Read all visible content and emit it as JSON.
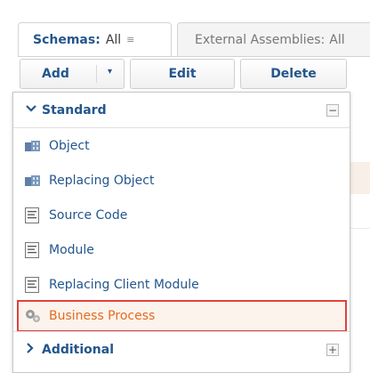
{
  "tabs": {
    "schemas_title": "Schemas:",
    "schemas_value": "All",
    "schemas_arrow": "≡",
    "external_title": "External Assemblies:",
    "external_value": "All"
  },
  "toolbar": {
    "add_label": "Add",
    "add_caret": "▾",
    "edit_label": "Edit",
    "delete_label": "Delete"
  },
  "menu": {
    "standard": {
      "label": "Standard",
      "chevron": "✔",
      "toggle": "−",
      "items": [
        {
          "label": "Object",
          "icon": "object-icon"
        },
        {
          "label": "Replacing Object",
          "icon": "object-icon"
        },
        {
          "label": "Source Code",
          "icon": "document-icon"
        },
        {
          "label": "Module",
          "icon": "document-icon"
        },
        {
          "label": "Replacing Client Module",
          "icon": "document-icon"
        },
        {
          "label": "Business Process",
          "icon": "gears-icon"
        }
      ]
    },
    "additional": {
      "label": "Additional",
      "chevron": "›",
      "toggle": "+"
    }
  },
  "colors": {
    "link": "#24568c",
    "highlight_border": "#e3403a",
    "highlight_text": "#e36c1f"
  }
}
